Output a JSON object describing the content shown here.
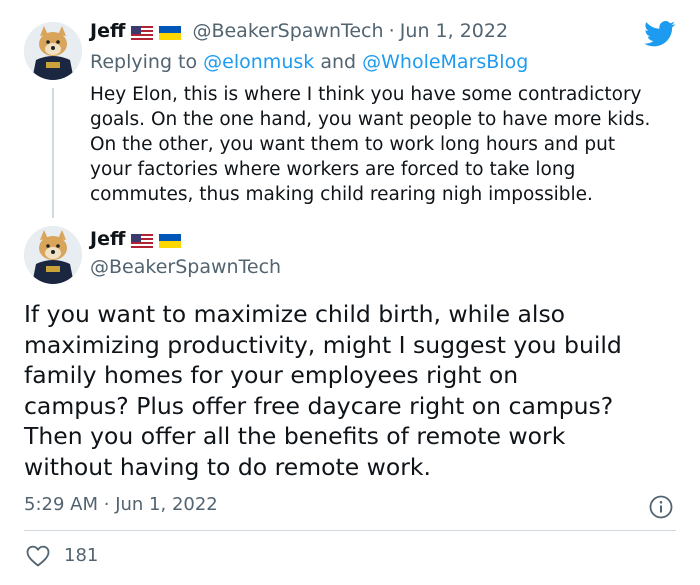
{
  "first_tweet": {
    "author_name": "Jeff",
    "handle": "@BeakerSpawnTech",
    "separator": "·",
    "date": "Jun 1, 2022",
    "replying_prefix": "Replying to",
    "replying_user1": "@elonmusk",
    "replying_and": "and",
    "replying_user2": "@WholeMarsBlog",
    "lines": [
      "Hey Elon, this is where I think you have some contradictory",
      "goals. On the one hand, you want people to have more kids.",
      "On the other, you want them to work long hours and put",
      "your factories where workers are forced to take long",
      "commutes, thus making child rearing nigh impossible."
    ]
  },
  "main_tweet": {
    "author_name": "Jeff",
    "handle": "@BeakerSpawnTech",
    "lines": [
      "If you want to maximize child birth, while also",
      "maximizing productivity, might I suggest you build",
      "family homes for your employees right on",
      "campus? Plus offer free daycare right on campus?",
      "Then you offer all the benefits of remote work",
      "without having to do remote work."
    ],
    "time": "5:29 AM",
    "separator": "·",
    "date": "Jun 1, 2022",
    "like_count": "181"
  },
  "icons": {
    "brand": "twitter-bird-icon",
    "info": "info-icon",
    "like": "heart-icon"
  },
  "colors": {
    "brand_blue": "#1d9bf0",
    "secondary_text": "#536471",
    "primary_text": "#0f1419",
    "divider": "#cfd9de"
  }
}
